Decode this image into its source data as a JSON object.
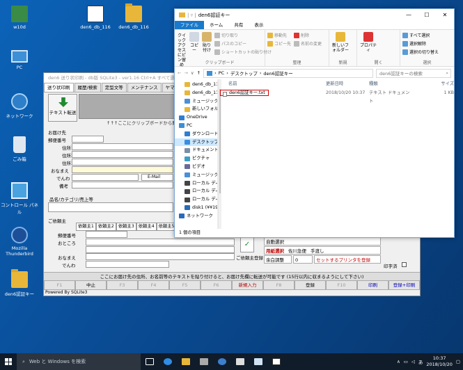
{
  "desktop": {
    "icons": [
      {
        "label": "w10d",
        "kind": "user"
      },
      {
        "label": "den6_db_116",
        "kind": "db"
      },
      {
        "label": "den6_db_116",
        "kind": "folder"
      },
      {
        "label": "PC",
        "kind": "pc"
      },
      {
        "label": "ネットワーク",
        "kind": "net"
      },
      {
        "label": "ごみ箱",
        "kind": "trash"
      },
      {
        "label": "コントロール パネル",
        "kind": "cpanel"
      },
      {
        "label": "Mozilla Thunderbird",
        "kind": "tb"
      },
      {
        "label": "den6認証キー",
        "kind": "folder"
      }
    ]
  },
  "app": {
    "title": "den6 送り状印刷 - db版 SQLite3 - ver1.16   Ctrl+A すべて選択",
    "tabs": [
      "送り状印刷",
      "履歴/検索",
      "定型文等",
      "メンテナンス",
      "ヤマト"
    ],
    "send_button": "テキスト転送",
    "paste_hint": "↑↑↑ここにクリップボードから貼り",
    "form_labels": [
      "お届け先",
      "郵便番号",
      "住所1",
      "住所2",
      "住所3",
      "おなまえ",
      "でんわ",
      "備考"
    ],
    "email_label": "E-Mail",
    "product_label": "品名/カテゴリ/売上等",
    "client_label": "ご依頼主",
    "client_tabs": [
      "依頼主1",
      "依頼主2",
      "依頼主3",
      "依頼主4",
      "依頼主5"
    ],
    "client_labels": [
      "郵便番号",
      "おところ",
      "おなまえ",
      "でんわ"
    ],
    "register_label": "ご依頼主登録",
    "right_panel": {
      "auto_select": "自動選択",
      "paper_label": "用紙選択",
      "carrier": "佐川急便",
      "carrier_type": "手渡し",
      "remaining_label": "余白調整",
      "remaining_value": "0",
      "printer_button": "セットするプリンタを登録",
      "print_check": "印字済"
    },
    "bottom_message": "ここにお届け先の住所、お名前等のテキストを貼り付けると、お届け先欄に転送が可能です (15行以内に収まるようにして下さい)",
    "fkeys": [
      {
        "label": "F1",
        "style": ""
      },
      {
        "label": "中止",
        "style": "on"
      },
      {
        "label": "F3",
        "style": ""
      },
      {
        "label": "F4",
        "style": ""
      },
      {
        "label": "F5",
        "style": ""
      },
      {
        "label": "F6",
        "style": ""
      },
      {
        "label": "新規入力",
        "style": "red"
      },
      {
        "label": "F8",
        "style": ""
      },
      {
        "label": "登録",
        "style": "on"
      },
      {
        "label": "F10",
        "style": ""
      },
      {
        "label": "印刷",
        "style": "blue"
      },
      {
        "label": "登録+印刷",
        "style": "blue"
      }
    ],
    "powered": "Powered By SQLite3"
  },
  "explorer": {
    "title": "den6認証キー",
    "ribbon_tabs": [
      "ファイル",
      "ホーム",
      "共有",
      "表示"
    ],
    "ribbon": {
      "clipboard": {
        "label": "クリップボード",
        "quick_access": "クイック アクセスにピン留め",
        "copy": "コピー",
        "paste": "貼り付け",
        "cut": "切り取り",
        "copy_path": "パスのコピー",
        "paste_shortcut": "ショートカットの貼り付け"
      },
      "organize": {
        "label": "整理",
        "move_to": "移動先",
        "copy_to": "コピー先",
        "delete": "削除",
        "rename": "名前の変更"
      },
      "new": {
        "label": "新規",
        "new_folder": "新しいフォルダー"
      },
      "open": {
        "label": "開く",
        "properties": "プロパティ"
      },
      "select": {
        "label": "選択",
        "select_all": "すべて選択",
        "select_none": "選択解除",
        "invert": "選択の切り替え"
      }
    },
    "address": [
      "PC",
      "デスクトップ",
      "den6認証キー"
    ],
    "search_placeholder": "den6認証キーの検索",
    "nav": [
      {
        "label": "den6_db_116",
        "icon": "folder",
        "top": false,
        "sel": false
      },
      {
        "label": "den6_db_116_mc",
        "icon": "folder",
        "top": false,
        "sel": false
      },
      {
        "label": "ミュージック",
        "icon": "music",
        "top": false,
        "sel": false
      },
      {
        "label": "新しいフォルダー (5",
        "icon": "folder",
        "top": false,
        "sel": false
      },
      {
        "label": "OneDrive",
        "icon": "cloud",
        "top": true,
        "sel": false
      },
      {
        "label": "PC",
        "icon": "pc",
        "top": true,
        "sel": false
      },
      {
        "label": "ダウンロード",
        "icon": "download",
        "top": false,
        "sel": false
      },
      {
        "label": "デスクトップ",
        "icon": "desktop",
        "top": false,
        "sel": true
      },
      {
        "label": "ドキュメント",
        "icon": "doc",
        "top": false,
        "sel": false
      },
      {
        "label": "ピクチャ",
        "icon": "pic",
        "top": false,
        "sel": false
      },
      {
        "label": "ビデオ",
        "icon": "video",
        "top": false,
        "sel": false
      },
      {
        "label": "ミュージック",
        "icon": "music",
        "top": false,
        "sel": false
      },
      {
        "label": "ローカル ディスク (C",
        "icon": "disk",
        "top": false,
        "sel": false
      },
      {
        "label": "ローカル ディスク (D",
        "icon": "disk",
        "top": false,
        "sel": false
      },
      {
        "label": "ローカル ディスク (E",
        "icon": "disk",
        "top": false,
        "sel": false
      },
      {
        "label": "disk1 (¥¥192.168",
        "icon": "net",
        "top": false,
        "sel": false
      },
      {
        "label": "ネットワーク",
        "icon": "net",
        "top": true,
        "sel": false
      }
    ],
    "columns": [
      "名前",
      "更新日時",
      "種類",
      "サイズ"
    ],
    "files": [
      {
        "name": "den6認証キー.txt",
        "date": "2018/10/20 10:37",
        "type": "テキスト ドキュメント",
        "size": "1 KB"
      }
    ],
    "status": "1 個の項目"
  },
  "taskbar": {
    "search_placeholder": "Web と Windows を検索",
    "time": "10:37",
    "date": "2018/10/20",
    "ime": "あ"
  }
}
